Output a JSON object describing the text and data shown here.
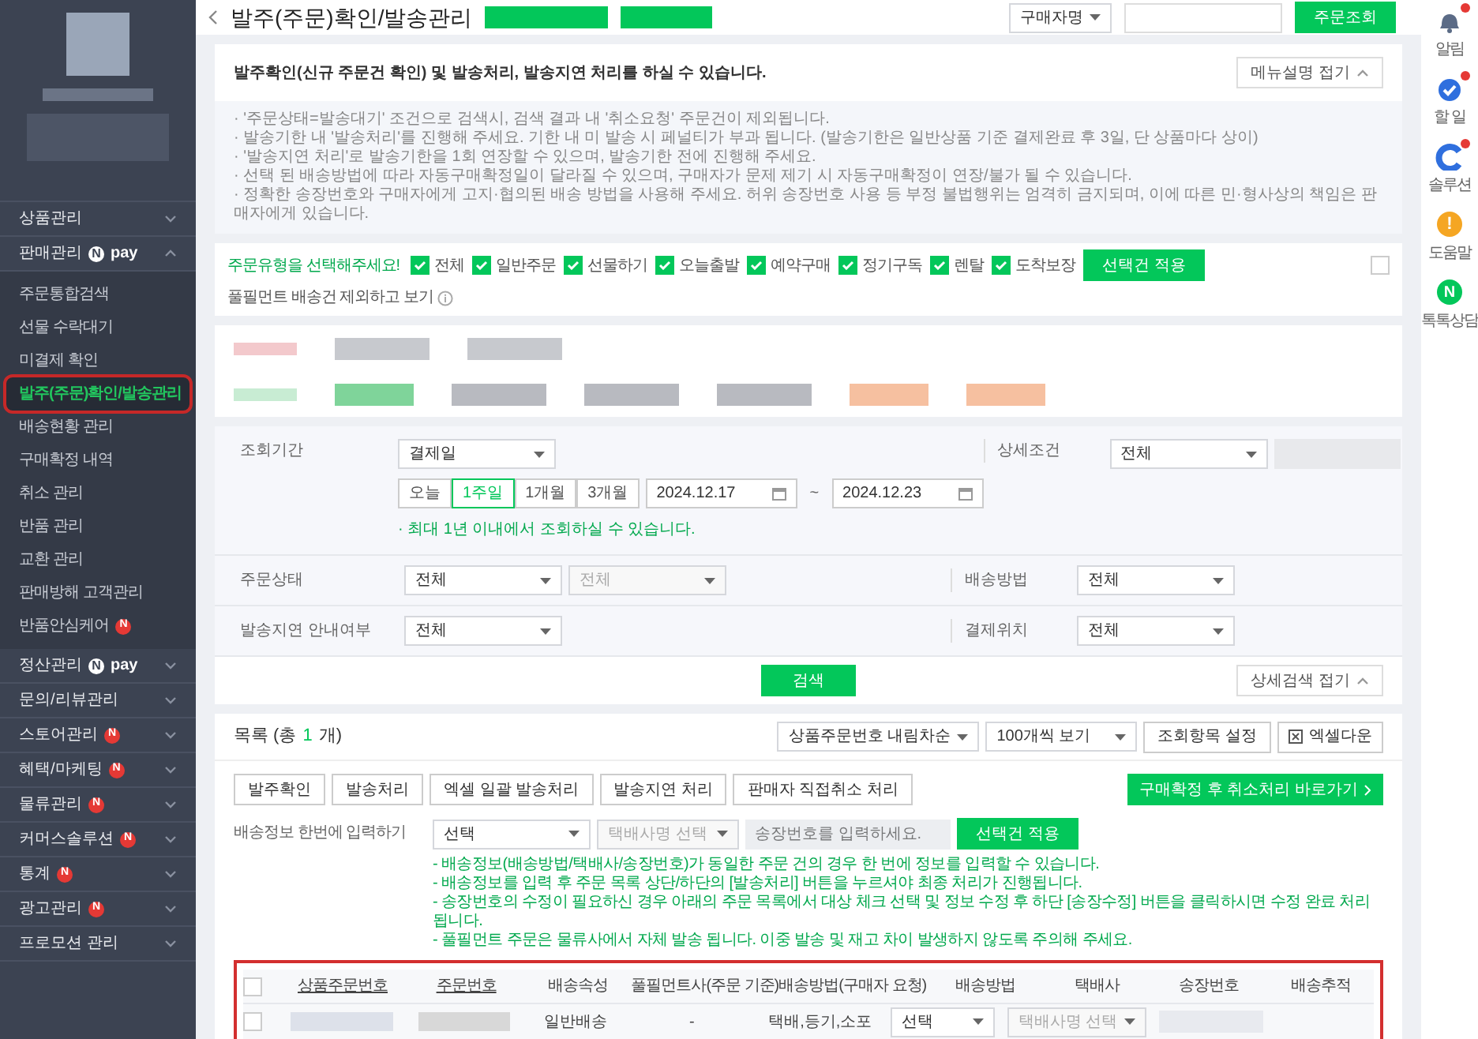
{
  "sidebar": {
    "menu": [
      {
        "label": "상품관리",
        "expanded": false
      },
      {
        "label": "판매관리",
        "pay_mark": "N",
        "pay_text": "pay",
        "expanded": true,
        "children": [
          {
            "label": "주문통합검색",
            "selected": false
          },
          {
            "label": "선물 수락대기",
            "selected": false
          },
          {
            "label": "미결제 확인",
            "selected": false
          },
          {
            "label": "발주(주문)확인/발송관리",
            "selected": true,
            "highlight": true
          },
          {
            "label": "배송현황 관리",
            "selected": false
          },
          {
            "label": "구매확정 내역",
            "selected": false
          },
          {
            "label": "취소 관리",
            "selected": false
          },
          {
            "label": "반품 관리",
            "selected": false
          },
          {
            "label": "교환 관리",
            "selected": false
          },
          {
            "label": "판매방해 고객관리",
            "selected": false
          },
          {
            "label": "반품안심케어",
            "badge": "N",
            "selected": false
          }
        ]
      },
      {
        "label": "정산관리",
        "pay_mark": "N",
        "pay_text": "pay",
        "expanded": false
      },
      {
        "label": "문의/리뷰관리",
        "expanded": false
      },
      {
        "label": "스토어관리",
        "badge": "N",
        "expanded": false
      },
      {
        "label": "혜택/마케팅",
        "badge": "N",
        "expanded": false
      },
      {
        "label": "물류관리",
        "badge": "N",
        "expanded": false
      },
      {
        "label": "커머스솔루션",
        "badge": "N",
        "expanded": false
      },
      {
        "label": "통계",
        "badge": "N",
        "expanded": false
      },
      {
        "label": "광고관리",
        "badge": "N",
        "expanded": false
      },
      {
        "label": "프로모션 관리",
        "expanded": false
      }
    ]
  },
  "header": {
    "title": "발주(주문)확인/발송관리",
    "search_type": "구매자명",
    "search_button": "주문조회"
  },
  "intro": {
    "heading": "발주확인(신규 주문건 확인) 및 발송처리, 발송지연 처리를 하실 수 있습니다.",
    "collapse_button": "메뉴설명 접기",
    "notes": [
      "· '주문상태=발송대기' 조건으로 검색시, 검색 결과 내 '취소요청' 주문건이 제외됩니다.",
      "· 발송기한 내 '발송처리'를 진행해 주세요. 기한 내 미 발송 시 페널티가 부과 됩니다. (발송기한은 일반상품 기준 결제완료 후 3일, 단 상품마다 상이)",
      "· '발송지연 처리'로 발송기한을 1회 연장할 수 있으며, 발송기한 전에 진행해 주세요.",
      "· 선택 된 배송방법에 따라 자동구매확정일이 달라질 수 있으며, 구매자가 문제 제기 시 자동구매확정이 연장/불가 될 수 있습니다.",
      "· 정확한 송장번호와 구매자에게 고지·협의된 배송 방법을 사용해 주세요. 허위 송장번호 사용 등 부정 불법행위는 엄격히 금지되며, 이에 따른 민·형사상의 책임은 판매자에게 있습니다."
    ]
  },
  "order_types": {
    "prompt": "주문유형을 선택해주세요!",
    "options": [
      {
        "label": "전체",
        "checked": true
      },
      {
        "label": "일반주문",
        "checked": true
      },
      {
        "label": "선물하기",
        "checked": true
      },
      {
        "label": "오늘출발",
        "checked": true
      },
      {
        "label": "예약구매",
        "checked": true
      },
      {
        "label": "정기구독",
        "checked": true
      },
      {
        "label": "렌탈",
        "checked": true
      },
      {
        "label": "도착보장",
        "checked": true
      }
    ],
    "apply_button": "선택건 적용",
    "fulfillment": {
      "label": "풀필먼트 배송건 제외하고 보기",
      "checked": false
    }
  },
  "search": {
    "period": {
      "label": "조회기간",
      "type": "결제일",
      "quick": [
        {
          "label": "오늘",
          "selected": false
        },
        {
          "label": "1주일",
          "selected": true
        },
        {
          "label": "1개월",
          "selected": false
        },
        {
          "label": "3개월",
          "selected": false
        }
      ],
      "from": "2024.12.17",
      "sep": "~",
      "to": "2024.12.23",
      "hint": "· 최대 1년 이내에서 조회하실 수 있습니다."
    },
    "detail": {
      "label": "상세조건",
      "value": "전체"
    },
    "status": {
      "label": "주문상태",
      "value": "전체",
      "sub_value": "전체",
      "sub_disabled": true
    },
    "delivery": {
      "label": "배송방법",
      "value": "전체"
    },
    "delay": {
      "label": "발송지연 안내여부",
      "value": "전체"
    },
    "pay_place": {
      "label": "결제위치",
      "value": "전체"
    },
    "search_button": "검색",
    "collapse_button": "상세검색 접기"
  },
  "list": {
    "title": "목록 (총",
    "count": "1",
    "title_end": "개)",
    "sort": "상품주문번호 내림차순",
    "page_size": "100개씩 보기",
    "column_settings": "조회항목 설정",
    "excel": "엑셀다운",
    "actions": [
      "발주확인",
      "발송처리",
      "엑셀 일괄 발송처리",
      "발송지연 처리",
      "판매자 직접취소 처리"
    ],
    "cancel_link": "구매확정 후 취소처리 바로가기",
    "bulk": {
      "label": "배송정보 한번에 입력하기",
      "method": "선택",
      "courier": "택배사명 선택",
      "courier_disabled": true,
      "tracking_placeholder": "송장번호를 입력하세요.",
      "apply": "선택건 적용"
    },
    "notes": [
      "- 배송정보(배송방법/택배사/송장번호)가 동일한 주문 건의 경우 한 번에 정보를 입력할 수 있습니다.",
      "- 배송정보를 입력 후 주문 목록 상단/하단의 [발송처리] 버튼을 누르셔야 최종 처리가 진행됩니다.",
      "- 송장번호의 수정이 필요하신 경우 아래의 주문 목록에서 대상 체크 선택 및 정보 수정 후 하단 [송장수정] 버튼을 클릭하시면 수정 완료 처리됩니다.",
      "- 풀필먼트 주문은 물류사에서 자체 발송 됩니다. 이중 발송 및 재고 차이 발생하지 않도록 주의해 주세요."
    ],
    "table": {
      "highlight": true,
      "columns": [
        {
          "label": "상품주문번호",
          "sortable": true
        },
        {
          "label": "주문번호",
          "sortable": true
        },
        {
          "label": "배송속성",
          "sortable": false
        },
        {
          "label": "풀필먼트사(주문 기준)",
          "sortable": false
        },
        {
          "label": "배송방법(구매자 요청)",
          "sortable": false
        },
        {
          "label": "배송방법",
          "sortable": false
        },
        {
          "label": "택배사",
          "sortable": false
        },
        {
          "label": "송장번호",
          "sortable": false
        },
        {
          "label": "배송추적",
          "sortable": false
        }
      ],
      "rows": [
        {
          "checked": false,
          "attribute": "일반배송",
          "fulfillment": "-",
          "requested": "택배,등기,소포",
          "method": "선택",
          "courier": "택배사명 선택",
          "courier_disabled": true
        }
      ]
    }
  },
  "right_rail": [
    {
      "label": "알림",
      "kind": "bell",
      "alert": true
    },
    {
      "label": "할 일",
      "kind": "check",
      "alert": true
    },
    {
      "label": "솔루션",
      "kind": "solution",
      "alert": true
    },
    {
      "label": "도움말",
      "kind": "help",
      "glyph": "!",
      "alert": false
    },
    {
      "label": "톡톡상담",
      "kind": "talk",
      "glyph": "N",
      "alert": false
    }
  ]
}
